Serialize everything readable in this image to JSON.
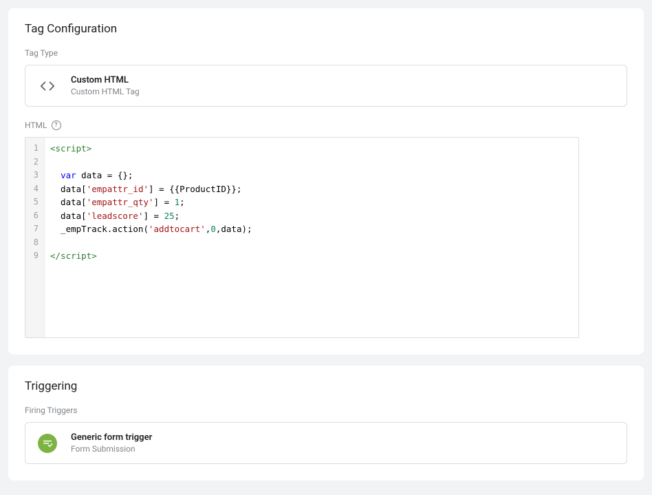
{
  "tagConfig": {
    "cardTitle": "Tag Configuration",
    "tagTypeLabel": "Tag Type",
    "tagTypeName": "Custom HTML",
    "tagTypeSubtitle": "Custom HTML Tag",
    "htmlLabel": "HTML",
    "code": {
      "lineNumbers": [
        "1",
        "2",
        "3",
        "4",
        "5",
        "6",
        "7",
        "8",
        "9"
      ],
      "lines": [
        {
          "parts": [
            {
              "t": "<script>",
              "c": "tok-tag"
            }
          ]
        },
        {
          "parts": []
        },
        {
          "parts": [
            {
              "t": "  ",
              "c": ""
            },
            {
              "t": "var",
              "c": "tok-keyword"
            },
            {
              "t": " ",
              "c": ""
            },
            {
              "t": "data",
              "c": "tok-var"
            },
            {
              "t": " = {};",
              "c": "tok-punct"
            }
          ]
        },
        {
          "parts": [
            {
              "t": "  data[",
              "c": "tok-punct"
            },
            {
              "t": "'empattr_id'",
              "c": "tok-string"
            },
            {
              "t": "] = {{ProductID}};",
              "c": "tok-punct"
            }
          ]
        },
        {
          "parts": [
            {
              "t": "  data[",
              "c": "tok-punct"
            },
            {
              "t": "'empattr_qty'",
              "c": "tok-string"
            },
            {
              "t": "] = ",
              "c": "tok-punct"
            },
            {
              "t": "1",
              "c": "tok-number"
            },
            {
              "t": ";",
              "c": "tok-punct"
            }
          ]
        },
        {
          "parts": [
            {
              "t": "  data[",
              "c": "tok-punct"
            },
            {
              "t": "'leadscore'",
              "c": "tok-string"
            },
            {
              "t": "] = ",
              "c": "tok-punct"
            },
            {
              "t": "25",
              "c": "tok-number"
            },
            {
              "t": ";",
              "c": "tok-punct"
            }
          ]
        },
        {
          "parts": [
            {
              "t": "  _empTrack.action(",
              "c": "tok-punct"
            },
            {
              "t": "'addtocart'",
              "c": "tok-string"
            },
            {
              "t": ",",
              "c": "tok-punct"
            },
            {
              "t": "0",
              "c": "tok-number"
            },
            {
              "t": ",data);",
              "c": "tok-punct"
            }
          ]
        },
        {
          "parts": []
        },
        {
          "parts": [
            {
              "t": "</script>",
              "c": "tok-tag"
            }
          ]
        }
      ]
    }
  },
  "triggering": {
    "cardTitle": "Triggering",
    "firingLabel": "Firing Triggers",
    "triggerName": "Generic form trigger",
    "triggerType": "Form Submission"
  }
}
